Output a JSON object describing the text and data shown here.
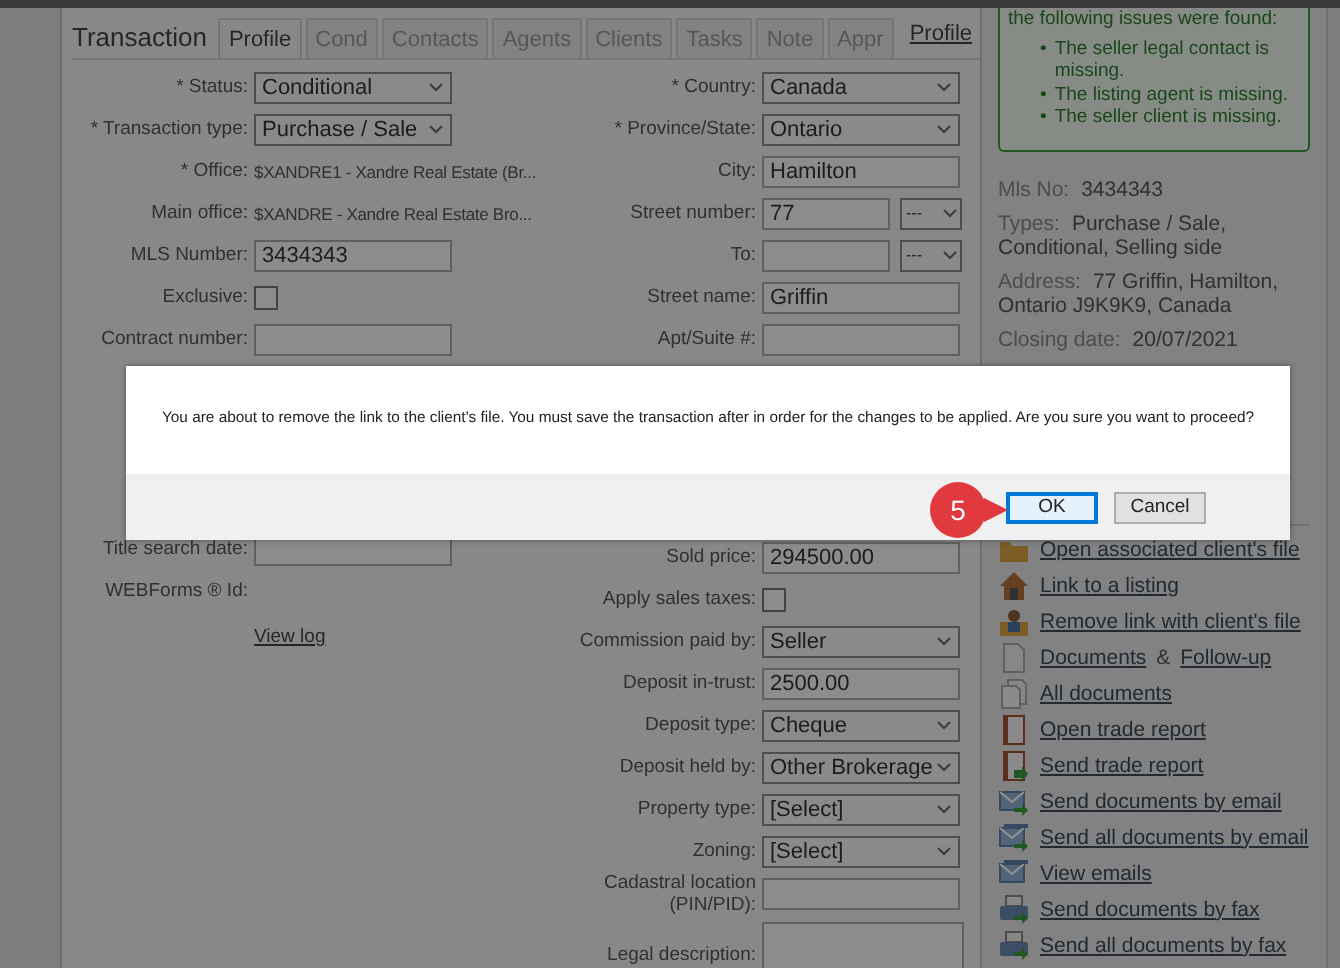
{
  "header": {
    "title": "Transaction",
    "tabs": [
      {
        "label": "Profile",
        "selected": true
      },
      {
        "label": "Cond",
        "selected": false
      },
      {
        "label": "Contacts",
        "selected": false
      },
      {
        "label": "Agents",
        "selected": false
      },
      {
        "label": "Clients",
        "selected": false
      },
      {
        "label": "Tasks",
        "selected": false
      },
      {
        "label": "Note",
        "selected": false
      },
      {
        "label": "Appr",
        "selected": false
      }
    ],
    "profile_link": "Profile"
  },
  "form": {
    "left": [
      {
        "kind": "select",
        "label": "* Status:",
        "value": "Conditional"
      },
      {
        "kind": "select",
        "label": "* Transaction type:",
        "value": "Purchase / Sale"
      },
      {
        "kind": "text",
        "label": "* Office:",
        "value": "$XANDRE1 - Xandre Real Estate (Br..."
      },
      {
        "kind": "text",
        "label": "Main office:",
        "value": "$XANDRE - Xandre Real Estate Bro..."
      },
      {
        "kind": "input",
        "label": "MLS Number:",
        "value": "3434343"
      },
      {
        "kind": "checkbox",
        "label": "Exclusive:",
        "checked": false
      },
      {
        "kind": "input",
        "label": "Contract number:"
      },
      {
        "kind": "gap"
      },
      {
        "kind": "input",
        "label": "Title search date:"
      },
      {
        "kind": "text",
        "label": "WEBForms ® Id:"
      },
      {
        "kind": "link",
        "value": "View log"
      }
    ],
    "right": [
      {
        "kind": "select",
        "label": "* Country:",
        "value": "Canada"
      },
      {
        "kind": "select",
        "label": "* Province/State:",
        "value": "Ontario"
      },
      {
        "kind": "input",
        "label": "City:",
        "value": "Hamilton"
      },
      {
        "kind": "input",
        "label": "Street number:",
        "value": "77",
        "extra": "---"
      },
      {
        "kind": "input",
        "label": "To:",
        "extra": "---"
      },
      {
        "kind": "input",
        "label": "Street name:",
        "value": "Griffin"
      },
      {
        "kind": "input",
        "label": "Apt/Suite #:"
      },
      {
        "kind": "gap"
      },
      {
        "kind": "input",
        "label": "Sold price:",
        "value": "294500.00"
      },
      {
        "kind": "checkbox",
        "label": "Apply sales taxes:",
        "checked": false
      },
      {
        "kind": "select",
        "label": "Commission paid by:",
        "value": "Seller"
      },
      {
        "kind": "input",
        "label": "Deposit in-trust:",
        "value": "2500.00"
      },
      {
        "kind": "select",
        "label": "Deposit type:",
        "value": "Cheque"
      },
      {
        "kind": "select",
        "label": "Deposit held by:",
        "value": "Other Brokerage"
      },
      {
        "kind": "select",
        "label": "Property type:",
        "value": "[Select]"
      },
      {
        "kind": "select",
        "label": "Zoning:",
        "value": "[Select]"
      },
      {
        "kind": "input",
        "label": "Cadastral location (PIN/PID):"
      },
      {
        "kind": "textarea",
        "label": "Legal description:"
      }
    ]
  },
  "sidebar": {
    "marker": "•",
    "issues_intro": "the following issues were found:",
    "issues": [
      "The seller legal contact is missing.",
      "The listing agent is missing.",
      "The seller client is missing."
    ],
    "summary": [
      {
        "label": "Mls No:",
        "lines": [
          "3434343"
        ]
      },
      {
        "label": "Types:",
        "lines": [
          "Purchase / Sale,",
          "Conditional, Selling side"
        ]
      },
      {
        "label": "Address:",
        "lines": [
          "77 Griffin, Hamilton,",
          "Ontario J9K9K9, Canada"
        ]
      },
      {
        "label": "Closing date:",
        "lines": [
          "20/07/2021"
        ]
      }
    ],
    "links": [
      {
        "kind": "folder",
        "text": "Open associated client's file"
      },
      {
        "kind": "house",
        "text": "Link to a listing"
      },
      {
        "kind": "person",
        "text": "Remove link with client's file"
      },
      {
        "kind": "document",
        "text": "Documents",
        "joiner": "&",
        "text2": "Follow-up"
      },
      {
        "kind": "documents",
        "text": "All documents"
      },
      {
        "kind": "book",
        "text": "Open trade report"
      },
      {
        "kind": "book-arrow",
        "text": "Send trade report"
      },
      {
        "kind": "envelope-arrow",
        "text": "Send documents by email"
      },
      {
        "kind": "envelopes-arrow",
        "text": "Send all documents by email"
      },
      {
        "kind": "envelopes",
        "text": "View emails"
      },
      {
        "kind": "printer",
        "text": "Send documents by fax"
      },
      {
        "kind": "printer",
        "text": "Send all documents by fax"
      }
    ]
  },
  "dialog": {
    "message": "You are about to remove the link to the client's file. You must save the transaction after in order for the changes to be applied. Are you sure you want to proceed?",
    "buttons": [
      {
        "label": "OK",
        "selected": true
      },
      {
        "label": "Cancel",
        "selected": false
      }
    ],
    "step_badge": "5"
  }
}
